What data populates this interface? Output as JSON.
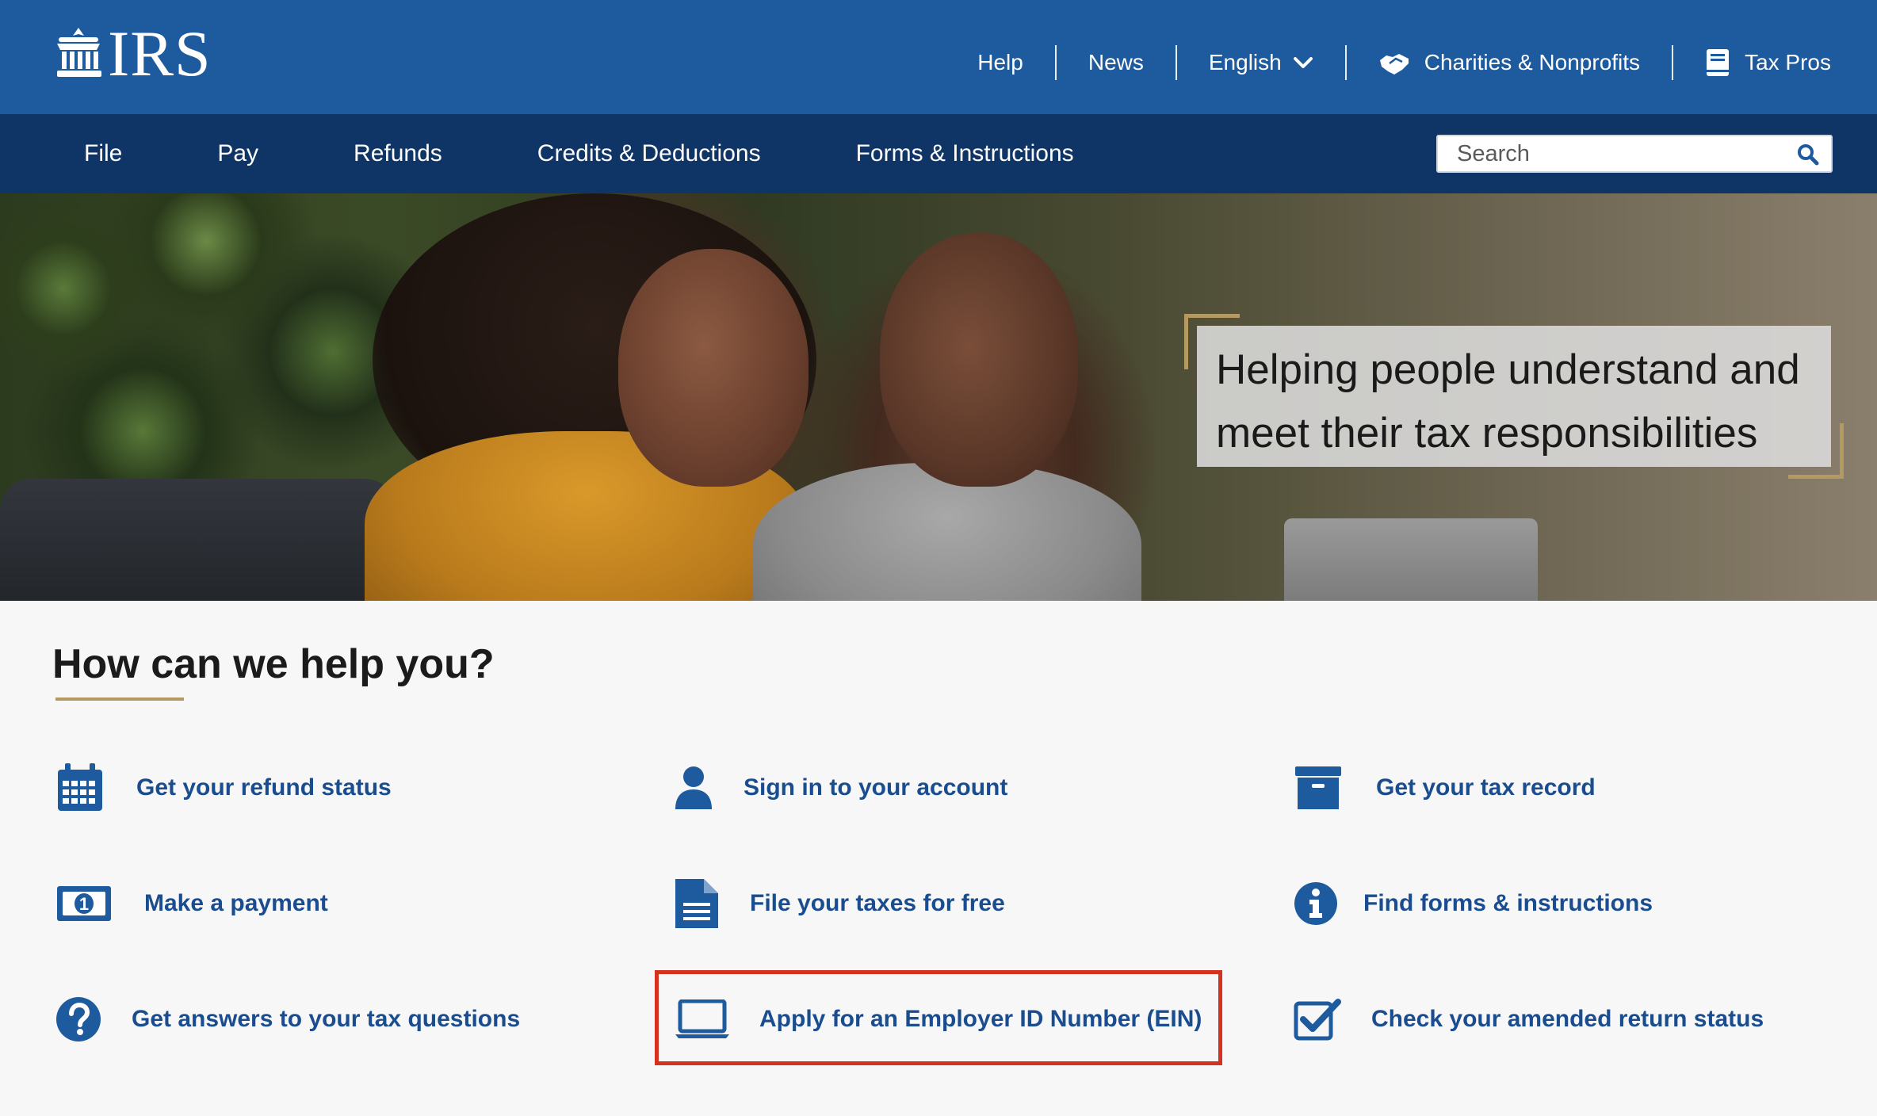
{
  "header": {
    "logo_text": "IRS",
    "utility_nav": [
      {
        "label": "Help"
      },
      {
        "label": "News"
      },
      {
        "label": "English"
      },
      {
        "label": "Charities & Nonprofits"
      },
      {
        "label": "Tax Pros"
      }
    ]
  },
  "main_nav": {
    "items": [
      {
        "label": "File"
      },
      {
        "label": "Pay"
      },
      {
        "label": "Refunds"
      },
      {
        "label": "Credits & Deductions"
      },
      {
        "label": "Forms & Instructions"
      }
    ],
    "search_placeholder": "Search"
  },
  "hero": {
    "tagline_line1": "Helping people understand and",
    "tagline_line2": "meet their tax responsibilities"
  },
  "help": {
    "title": "How can we help you?",
    "links": [
      {
        "label": "Get your refund status",
        "icon": "calendar-icon"
      },
      {
        "label": "Sign in to your account",
        "icon": "user-icon"
      },
      {
        "label": "Get your tax record",
        "icon": "archive-box-icon"
      },
      {
        "label": "Make a payment",
        "icon": "dollar-bill-icon"
      },
      {
        "label": "File your taxes for free",
        "icon": "document-icon"
      },
      {
        "label": "Find forms & instructions",
        "icon": "info-icon"
      },
      {
        "label": "Get answers to your tax questions",
        "icon": "question-icon"
      },
      {
        "label": "Apply for an Employer ID Number (EIN)",
        "icon": "laptop-icon"
      },
      {
        "label": "Check your amended return status",
        "icon": "checkbox-icon"
      }
    ]
  },
  "colors": {
    "header_blue": "#1e5a9e",
    "nav_dark_blue": "#0f3466",
    "link_blue": "#1a4d8f",
    "accent_gold": "#b49a60",
    "highlight_red": "#d3321f"
  }
}
